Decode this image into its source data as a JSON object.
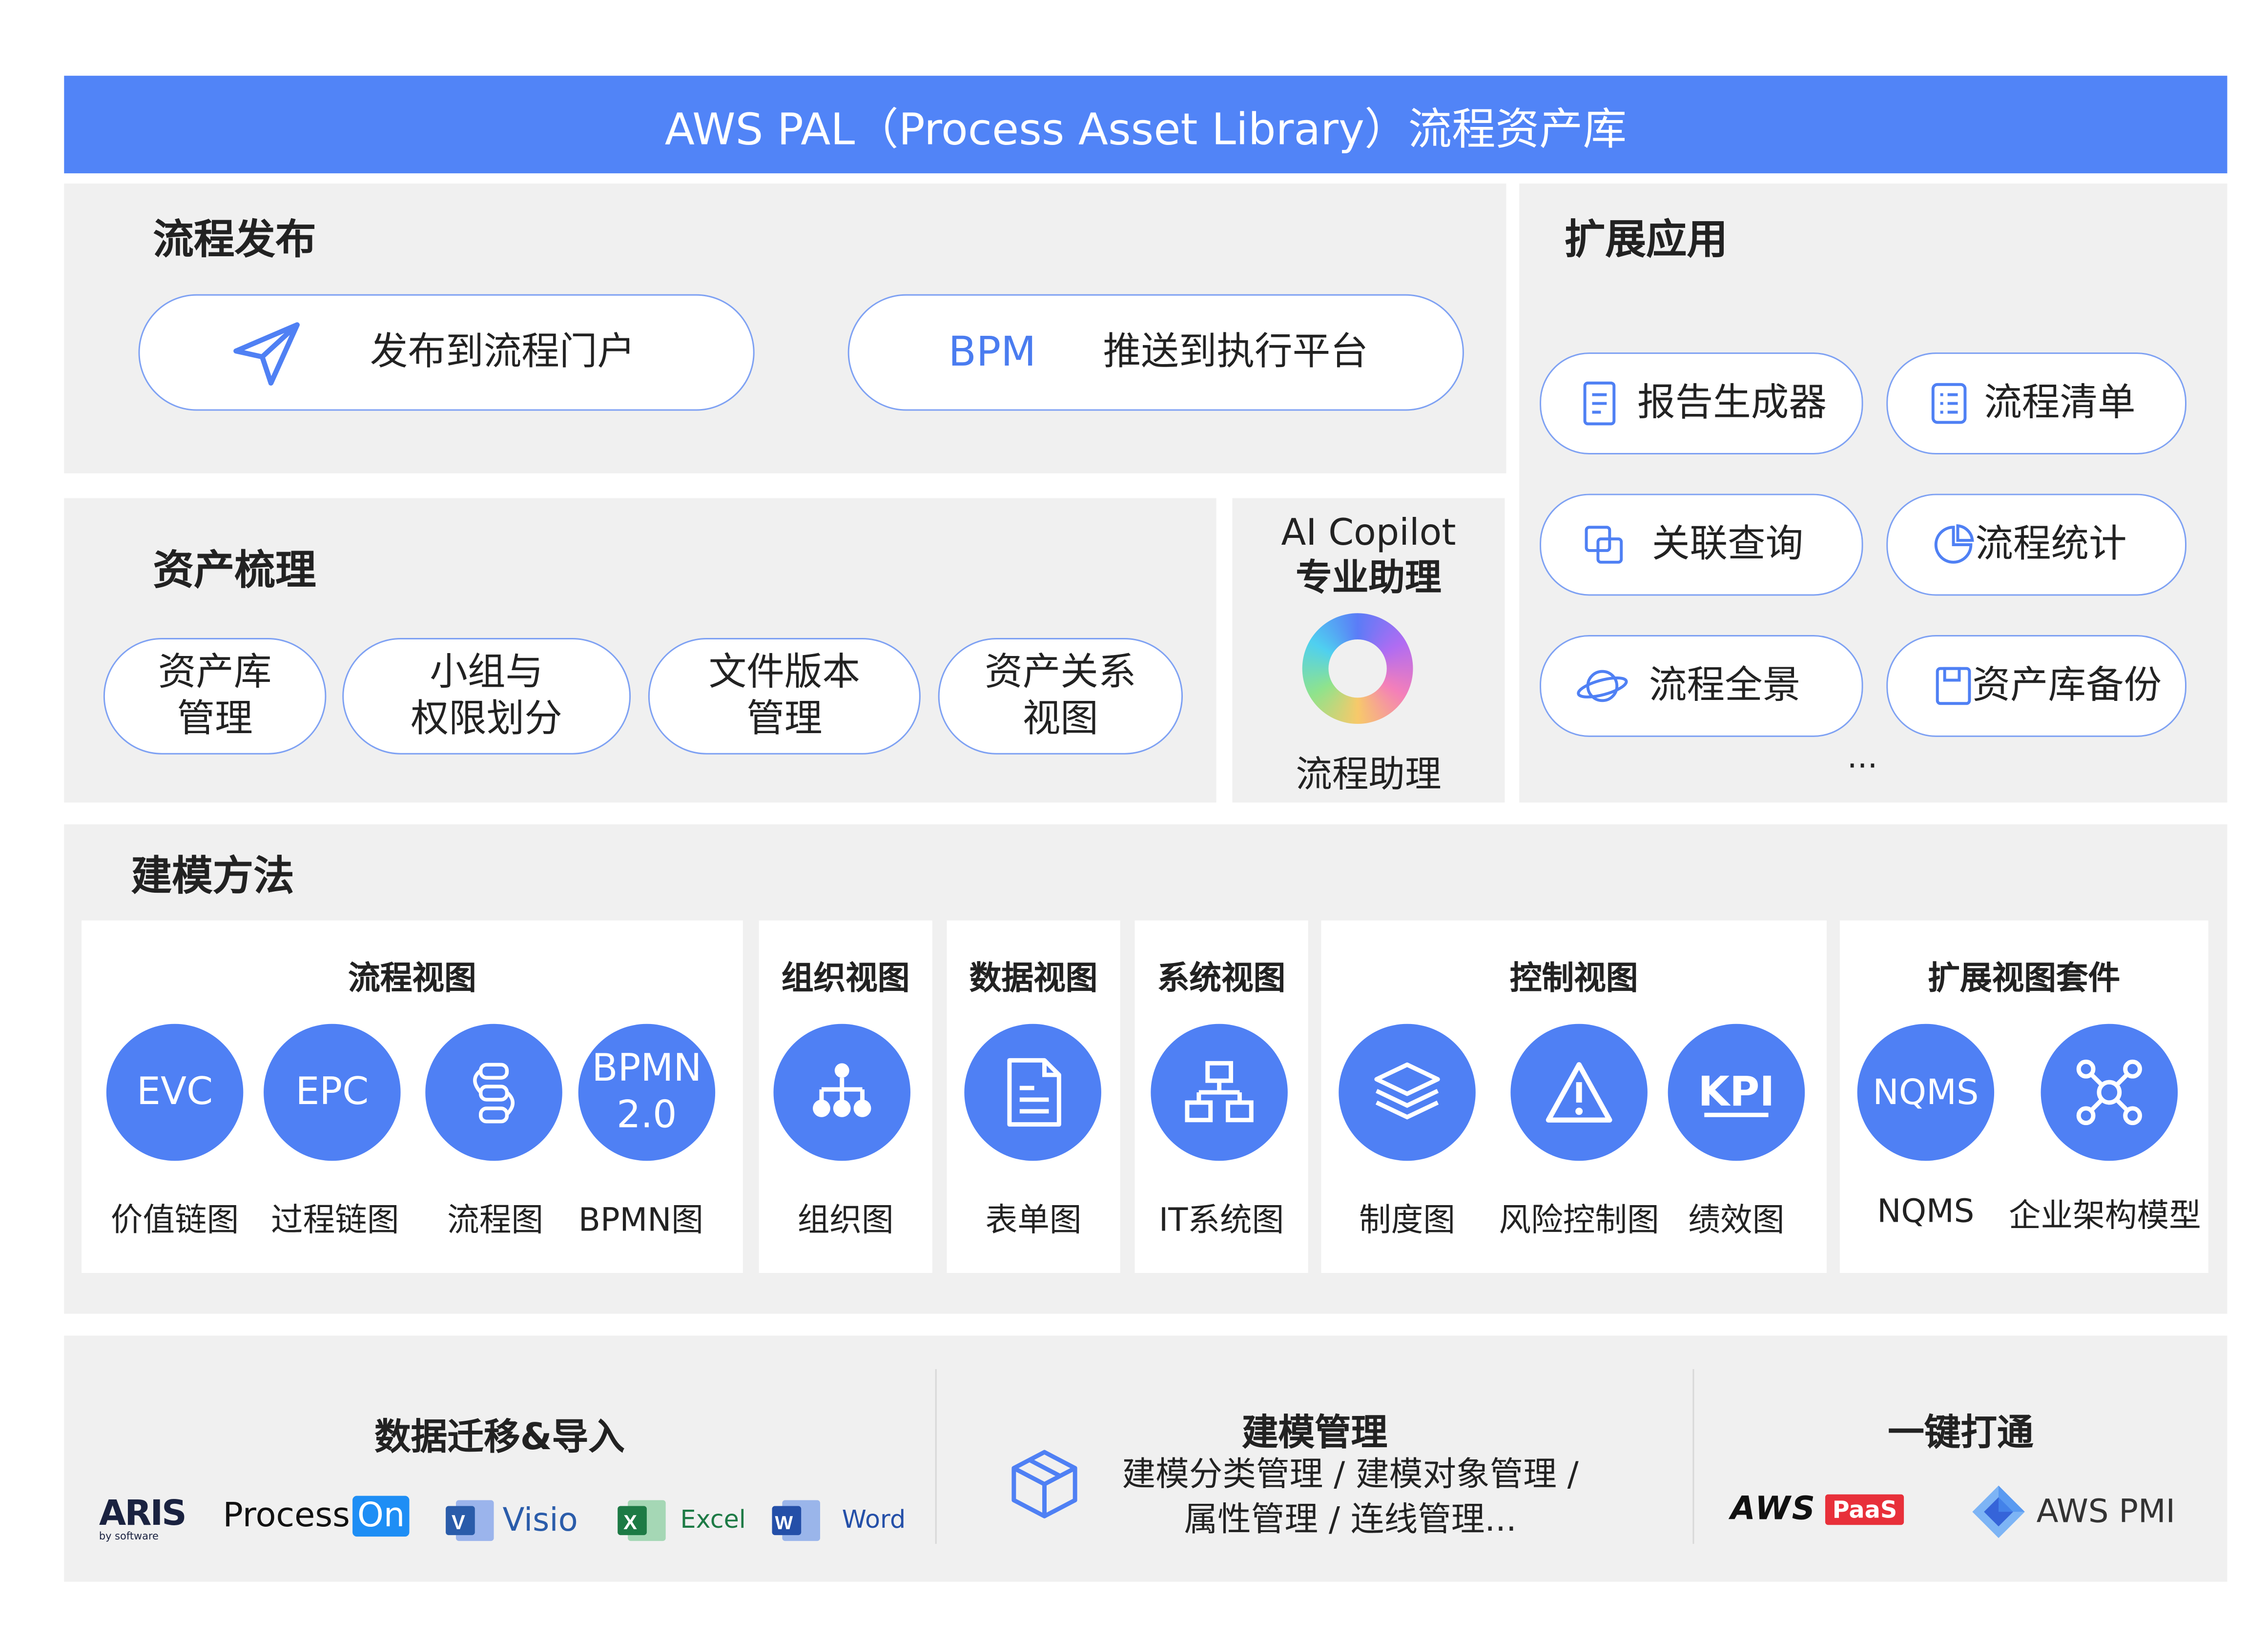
{
  "banner": {
    "title": "AWS PAL（Process Asset Library）流程资产库"
  },
  "publish": {
    "title": "流程发布",
    "portal_label": "发布到流程门户",
    "bpm_prefix": "BPM",
    "bpm_label": "推送到执行平台"
  },
  "extensions": {
    "title": "扩展应用",
    "items": [
      {
        "label": "报告生成器",
        "icon": "document-icon"
      },
      {
        "label": "流程清单",
        "icon": "checklist-icon"
      },
      {
        "label": "关联查询",
        "icon": "copy-icon"
      },
      {
        "label": "流程统计",
        "icon": "pie-chart-icon"
      },
      {
        "label": "流程全景",
        "icon": "planet-icon"
      },
      {
        "label": "资产库备份",
        "icon": "save-icon"
      }
    ],
    "more": "..."
  },
  "assets": {
    "title": "资产梳理",
    "items": [
      {
        "line1": "资产库",
        "line2": "管理"
      },
      {
        "line1": "小组与",
        "line2": "权限划分"
      },
      {
        "line1": "文件版本",
        "line2": "管理"
      },
      {
        "line1": "资产关系",
        "line2": "视图"
      }
    ]
  },
  "copilot": {
    "line1": "AI Copilot",
    "line2": "专业助理",
    "label": "流程助理"
  },
  "modeling": {
    "title": "建模方法",
    "cards": {
      "process": {
        "title": "流程视图",
        "items": [
          {
            "circle": "EVC",
            "label": "价值链图"
          },
          {
            "circle": "EPC",
            "label": "过程链图"
          },
          {
            "circle": "",
            "label": "流程图",
            "icon": "flow-icon"
          },
          {
            "circle1": "BPMN",
            "circle2": "2.0",
            "label": "BPMN图"
          }
        ]
      },
      "org": {
        "title": "组织视图",
        "label": "组织图",
        "icon": "org-chart-icon"
      },
      "data": {
        "title": "数据视图",
        "label": "表单图",
        "icon": "form-icon"
      },
      "system": {
        "title": "系统视图",
        "label": "IT系统图",
        "icon": "network-icon"
      },
      "control": {
        "title": "控制视图",
        "items": [
          {
            "label": "制度图",
            "icon": "layers-icon"
          },
          {
            "label": "风险控制图",
            "icon": "warning-icon"
          },
          {
            "circle": "KPI",
            "label": "绩效图"
          }
        ]
      },
      "extension": {
        "title": "扩展视图套件",
        "items": [
          {
            "circle": "NQMS",
            "label": "NQMS"
          },
          {
            "label": "企业架构模型",
            "icon": "hub-icon"
          }
        ]
      }
    }
  },
  "bottom": {
    "migration": {
      "title": "数据迁移&导入",
      "logos": {
        "aris": "ARIS",
        "aris_sub": "by software",
        "processon_a": "Process",
        "processon_b": "On",
        "visio": "Visio",
        "excel": "Excel",
        "word": "Word"
      }
    },
    "modeling_mgmt": {
      "title": "建模管理",
      "line1": "建模分类管理 / 建模对象管理 /",
      "line2": "属性管理 / 连线管理..."
    },
    "integration": {
      "title": "一键打通",
      "aws": "AWS",
      "paas": "PaaS",
      "pmi": "AWS PMI"
    }
  },
  "colors": {
    "primary": "#5184f7",
    "circle": "#4f80f4",
    "panel": "#f0f0f0"
  }
}
